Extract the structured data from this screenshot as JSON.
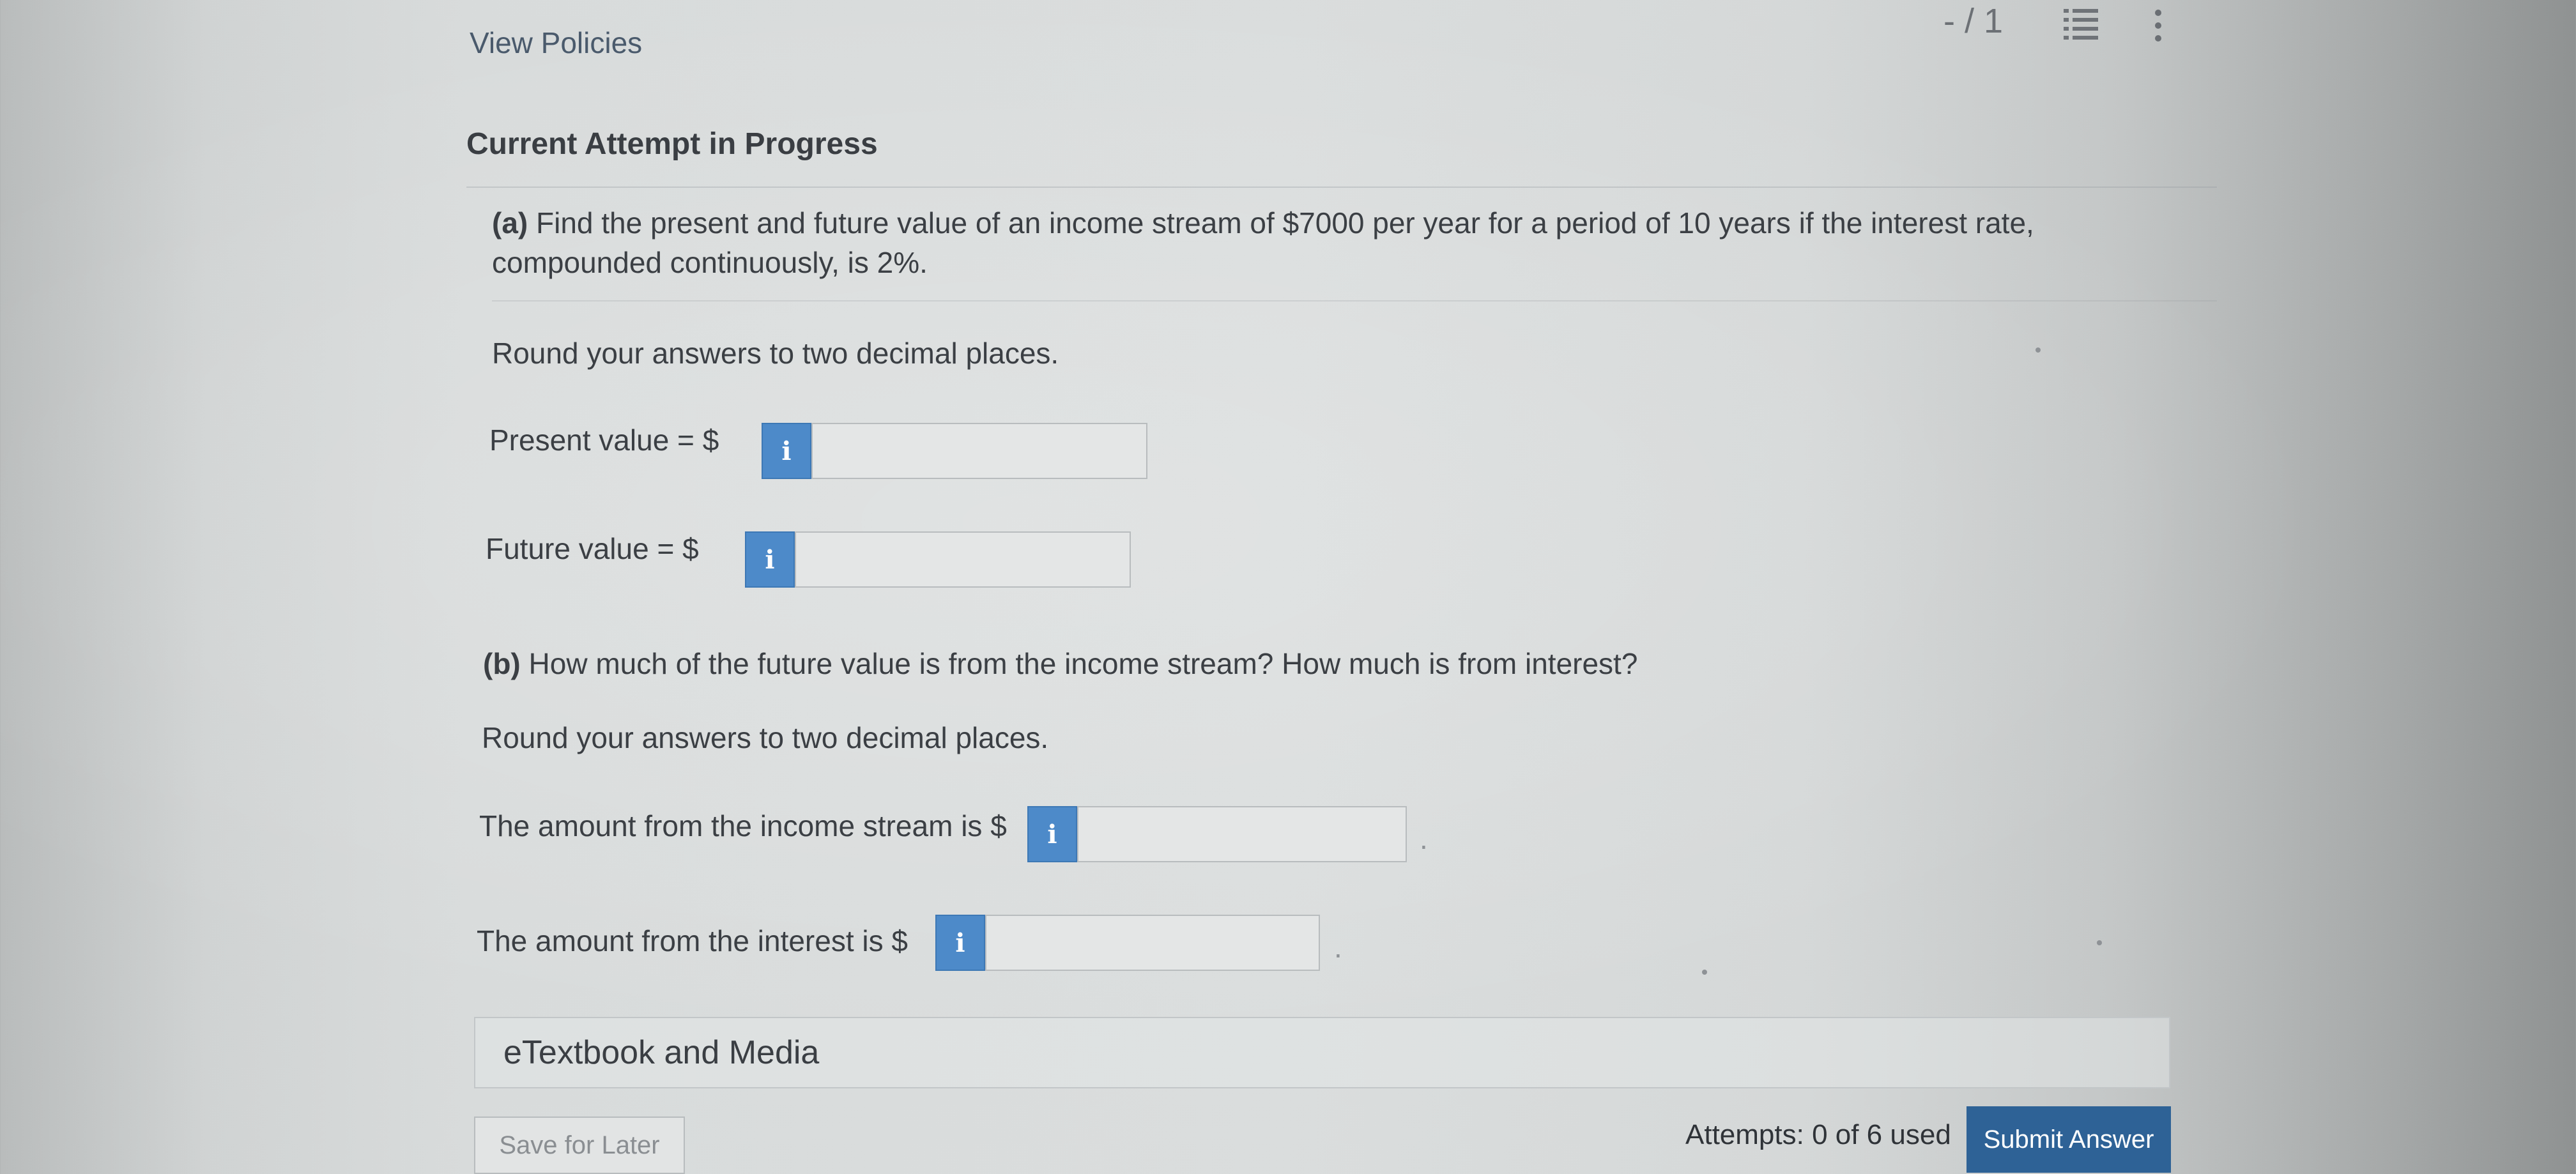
{
  "header": {
    "view_policies": "View Policies",
    "page_indicator": "- / 1"
  },
  "attempt_heading": "Current Attempt in Progress",
  "question": {
    "part_a_tag": "(a)",
    "part_a_text": "Find the present and future value of an income stream of $7000 per year for a period of 10 years if the interest rate, compounded continuously, is 2%.",
    "round_a": "Round your answers to two decimal places.",
    "present_label": "Present value  = $",
    "present_value": "",
    "future_label": "Future value  = $",
    "future_value": "",
    "part_b_tag": "(b)",
    "part_b_text": "How much of the future value is from the income stream? How much is from interest?",
    "round_b": "Round your answers to two decimal places.",
    "stream_label": "The amount from the income stream is $",
    "stream_value": "",
    "interest_label": "The amount from the interest is $",
    "interest_value": "",
    "info_glyph": "i",
    "period": "."
  },
  "etextbook_label": "eTextbook and Media",
  "footer": {
    "save_label": "Save for Later",
    "attempts_text": "Attempts: 0 of 6 used",
    "submit_label": "Submit Answer"
  },
  "colors": {
    "info_button": "#4d8ac9",
    "submit_button": "#2e6296"
  },
  "icons": [
    "list-icon",
    "more-vertical-icon",
    "info-icon"
  ]
}
